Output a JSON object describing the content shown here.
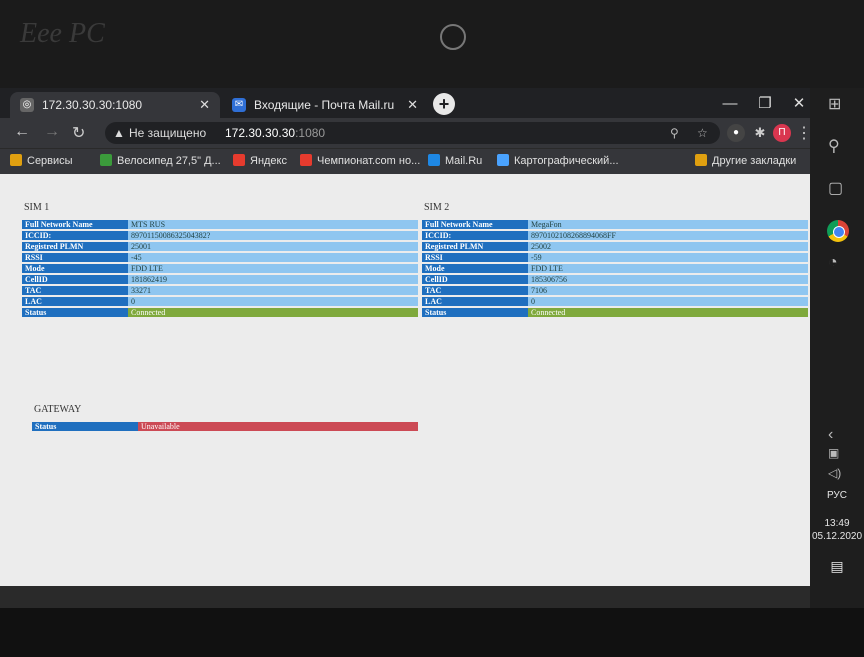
{
  "laptop": {
    "brand": "Eee PC"
  },
  "browser": {
    "tabs": [
      {
        "label": "172.30.30.30:1080",
        "active": true
      },
      {
        "label": "Входящие - Почта Mail.ru",
        "active": false
      }
    ],
    "address": {
      "security": "Не защищено",
      "host": "172.30.30.30",
      "port": ":1080"
    },
    "bookmarks": [
      {
        "label": "Сервисы",
        "color": "#e0a010"
      },
      {
        "label": "Велосипед 27,5\" Д...",
        "color": "#3b9b3b"
      },
      {
        "label": "Яндекс",
        "color": "#e63b2e"
      },
      {
        "label": "Чемпионат.com но...",
        "color": "#e63b2e"
      },
      {
        "label": "Mail.Ru",
        "color": "#1e88e5"
      },
      {
        "label": "Картографический...",
        "color": "#4aa3ff"
      }
    ],
    "other_bookmarks": "Другие закладки",
    "extension_label": "П",
    "icons": [
      "back-icon",
      "forward-icon",
      "reload-icon",
      "search-icon",
      "star-icon",
      "puzzle-icon",
      "menu-icon"
    ]
  },
  "sim1": {
    "title": "SIM 1",
    "rows": [
      {
        "label": "Full Network Name",
        "value": "MTS RUS"
      },
      {
        "label": "ICCID:",
        "value": "8970115008632504382?"
      },
      {
        "label": "Registred PLMN",
        "value": "25001"
      },
      {
        "label": "RSSI",
        "value": "-45"
      },
      {
        "label": "Mode",
        "value": "FDD LTE"
      },
      {
        "label": "CellID",
        "value": "181862419"
      },
      {
        "label": "TAC",
        "value": "33271"
      },
      {
        "label": "LAC",
        "value": "0"
      },
      {
        "label": "Status",
        "value": "Connected",
        "state": "ok"
      }
    ]
  },
  "sim2": {
    "title": "SIM 2",
    "rows": [
      {
        "label": "Full Network Name",
        "value": "MegaFon"
      },
      {
        "label": "ICCID:",
        "value": "8970102108268894068FF"
      },
      {
        "label": "Registred PLMN",
        "value": "25002"
      },
      {
        "label": "RSSI",
        "value": "-59"
      },
      {
        "label": "Mode",
        "value": "FDD LTE"
      },
      {
        "label": "CellID",
        "value": "185306756"
      },
      {
        "label": "TAC",
        "value": "7106"
      },
      {
        "label": "LAC",
        "value": "0"
      },
      {
        "label": "Status",
        "value": "Connected",
        "state": "ok"
      }
    ]
  },
  "gateway": {
    "title": "GATEWAY",
    "rows": [
      {
        "label": "Status",
        "value": "Unavailable",
        "state": "bad"
      }
    ]
  },
  "taskbar": {
    "lang": "РУС",
    "time": "13:49",
    "date": "05.12.2020"
  }
}
